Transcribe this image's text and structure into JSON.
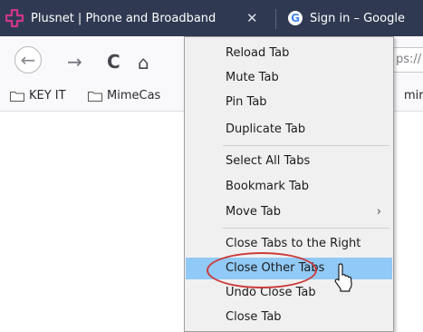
{
  "tabs": [
    {
      "title": "Plusnet | Phone and Broadband",
      "favicon": "plusnet-logo-icon",
      "close_glyph": "✕"
    },
    {
      "title": "Sign in – Google",
      "favicon": "google-g-icon",
      "favicon_letter": "G"
    }
  ],
  "nav": {
    "back_glyph": "←",
    "forward_glyph": "→",
    "reload_glyph": "C",
    "home_glyph": "⌂",
    "url_fragment": "ps://"
  },
  "bookmarks": [
    {
      "label": "KEY IT"
    },
    {
      "label": "MimeCas"
    },
    {
      "label": "mir"
    }
  ],
  "context_menu": {
    "items": [
      {
        "label": "Reload Tab"
      },
      {
        "label": "Mute Tab"
      },
      {
        "label": "Pin Tab"
      },
      {
        "label": "Duplicate Tab"
      },
      {
        "label": "Select All Tabs"
      },
      {
        "label": "Bookmark Tab"
      },
      {
        "label": "Move Tab",
        "submenu_glyph": "›"
      },
      {
        "label": "Close Tabs to the Right"
      },
      {
        "label": "Close Other Tabs",
        "highlighted": true
      },
      {
        "label": "Undo Close Tab"
      },
      {
        "label": "Close Tab"
      }
    ]
  },
  "colors": {
    "tab_strip": "#2f3a52",
    "menu_highlight": "#91c9f7",
    "annotation_circle": "#cc3b3b",
    "plusnet_brand": "#d1358a"
  }
}
